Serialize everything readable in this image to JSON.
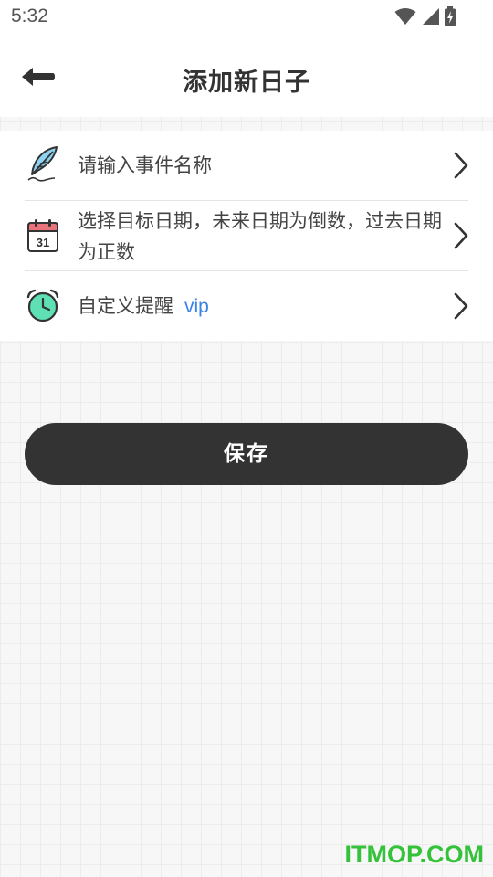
{
  "status_bar": {
    "time": "5:32",
    "icons": [
      "wifi-icon",
      "cellular-signal-icon",
      "battery-charging-icon"
    ]
  },
  "header": {
    "title": "添加新日子",
    "back_icon": "arrow-left-icon"
  },
  "form": {
    "event_name": {
      "placeholder": "请输入事件名称",
      "icon": "feather-pen-icon"
    },
    "date": {
      "placeholder": "选择目标日期，未来日期为倒数，过去日期为正数",
      "icon": "calendar-icon",
      "icon_text": "31"
    },
    "reminder": {
      "label": "自定义提醒",
      "badge": "vip",
      "icon": "alarm-clock-icon"
    }
  },
  "save_button": {
    "label": "保存"
  },
  "watermark": "ITMOP.COM",
  "colors": {
    "primary_dark": "#333333",
    "vip_blue": "#3b82e6",
    "alarm_teal": "#5ee0b4",
    "calendar_red": "#e8737a",
    "watermark_green": "#35c23a"
  }
}
